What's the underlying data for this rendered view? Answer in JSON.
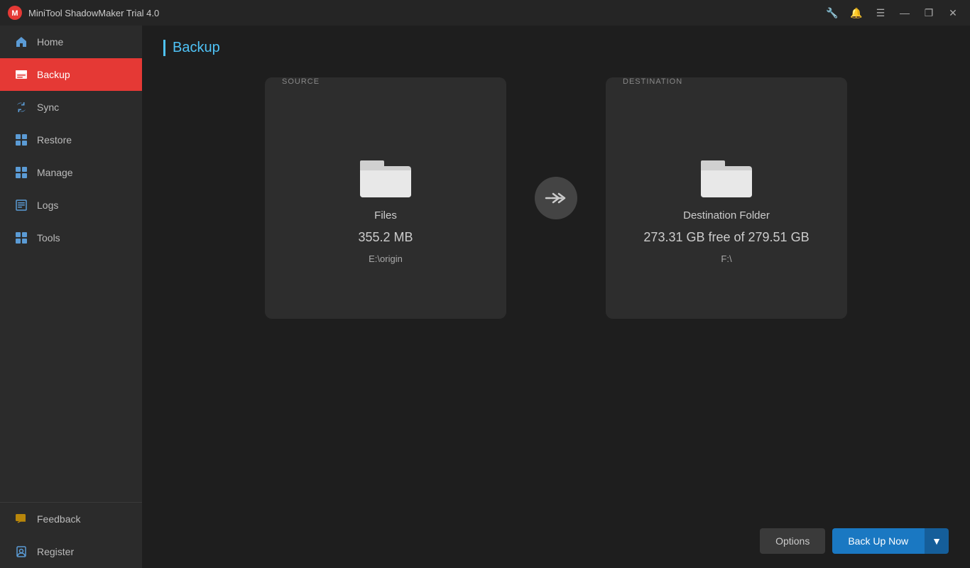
{
  "titlebar": {
    "app_name": "MiniTool ShadowMaker Trial 4.0",
    "controls": {
      "minimize": "—",
      "maximize": "❐",
      "close": "✕"
    },
    "extra_icons": [
      "🔧",
      "🔔",
      "☰"
    ]
  },
  "sidebar": {
    "items": [
      {
        "id": "home",
        "label": "Home",
        "active": false
      },
      {
        "id": "backup",
        "label": "Backup",
        "active": true
      },
      {
        "id": "sync",
        "label": "Sync",
        "active": false
      },
      {
        "id": "restore",
        "label": "Restore",
        "active": false
      },
      {
        "id": "manage",
        "label": "Manage",
        "active": false
      },
      {
        "id": "logs",
        "label": "Logs",
        "active": false
      },
      {
        "id": "tools",
        "label": "Tools",
        "active": false
      }
    ],
    "bottom_items": [
      {
        "id": "feedback",
        "label": "Feedback"
      },
      {
        "id": "register",
        "label": "Register"
      }
    ]
  },
  "page": {
    "title": "Backup"
  },
  "source": {
    "label": "SOURCE",
    "icon_type": "folder",
    "name": "Files",
    "size": "355.2 MB",
    "path": "E:\\origin"
  },
  "destination": {
    "label": "DESTINATION",
    "icon_type": "folder",
    "name": "Destination Folder",
    "free_space": "273.31 GB free of 279.51 GB",
    "path": "F:\\"
  },
  "arrow": {
    "symbol": "❯❯❯"
  },
  "buttons": {
    "options": "Options",
    "backup_now": "Back Up Now",
    "dropdown_arrow": "▼"
  }
}
